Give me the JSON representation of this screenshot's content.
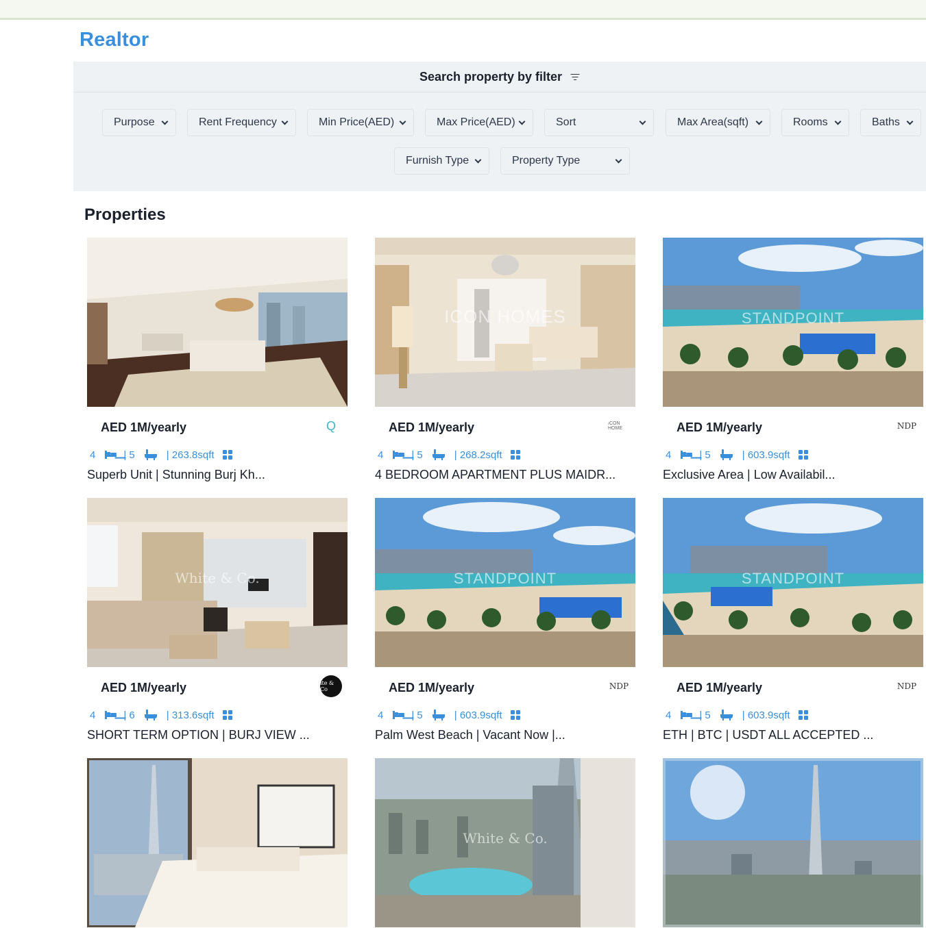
{
  "app": {
    "brand": "Realtor"
  },
  "filters": {
    "heading": "Search property by filter",
    "selects": [
      {
        "label": "Purpose"
      },
      {
        "label": "Rent Frequency"
      },
      {
        "label": "Min Price(AED)"
      },
      {
        "label": "Max Price(AED)"
      },
      {
        "label": "Sort"
      },
      {
        "label": "Max Area(sqft)"
      },
      {
        "label": "Rooms"
      },
      {
        "label": "Baths"
      },
      {
        "label": "Furnish Type"
      },
      {
        "label": "Property Type"
      }
    ]
  },
  "properties": {
    "heading": "Properties",
    "cards": [
      {
        "price": "AED 1M/yearly",
        "rooms": "4",
        "baths": "| 5",
        "area": "| 263.8sqft",
        "title": "Superb Unit | Stunning Burj Kh...",
        "agency_logo": "qmc-logo",
        "photo": "living-dining-interior"
      },
      {
        "price": "AED 1M/yearly",
        "rooms": "4",
        "baths": "| 5",
        "area": "| 268.2sqft",
        "title": "4 BEDROOM APARTMENT PLUS MAIDR...",
        "agency_logo": "icon-homes-logo",
        "photo": "living-room-interior",
        "watermark": "ICON HOMES"
      },
      {
        "price": "AED 1M/yearly",
        "rooms": "4",
        "baths": "| 5",
        "area": "| 603.9sqft",
        "title": "Exclusive Area | Low Availabil...",
        "agency_logo": "standpoint-logo",
        "photo": "beach-view",
        "watermark": "STANDPOINT"
      },
      {
        "price": "AED 1M/yearly",
        "rooms": "4",
        "baths": "| 6",
        "area": "| 313.6sqft",
        "title": "SHORT TERM OPTION | BURJ VIEW ...",
        "agency_logo": "white-co-logo",
        "photo": "living-room-sofa",
        "watermark": "White & Co."
      },
      {
        "price": "AED 1M/yearly",
        "rooms": "4",
        "baths": "| 5",
        "area": "| 603.9sqft",
        "title": "Palm West Beach | Vacant Now |...",
        "agency_logo": "standpoint-logo",
        "photo": "beach-view",
        "watermark": "STANDPOINT"
      },
      {
        "price": "AED 1M/yearly",
        "rooms": "4",
        "baths": "| 5",
        "area": "| 603.9sqft",
        "title": "ETH | BTC | USDT ALL ACCEPTED ...",
        "agency_logo": "standpoint-logo",
        "photo": "beach-view",
        "watermark": "STANDPOINT"
      },
      {
        "photo": "bedroom-burj-view"
      },
      {
        "photo": "balcony-burj-view",
        "watermark": "White & Co."
      },
      {
        "photo": "skyline-burj-view"
      }
    ]
  },
  "logos": {
    "qmc": "Q",
    "icon_homes": "ICON HOME",
    "standpoint": "NDP",
    "white_co": "ite & Co"
  },
  "colors": {
    "accent": "#3a8fdc",
    "panel": "#eef2f5",
    "text": "#1a202c"
  }
}
